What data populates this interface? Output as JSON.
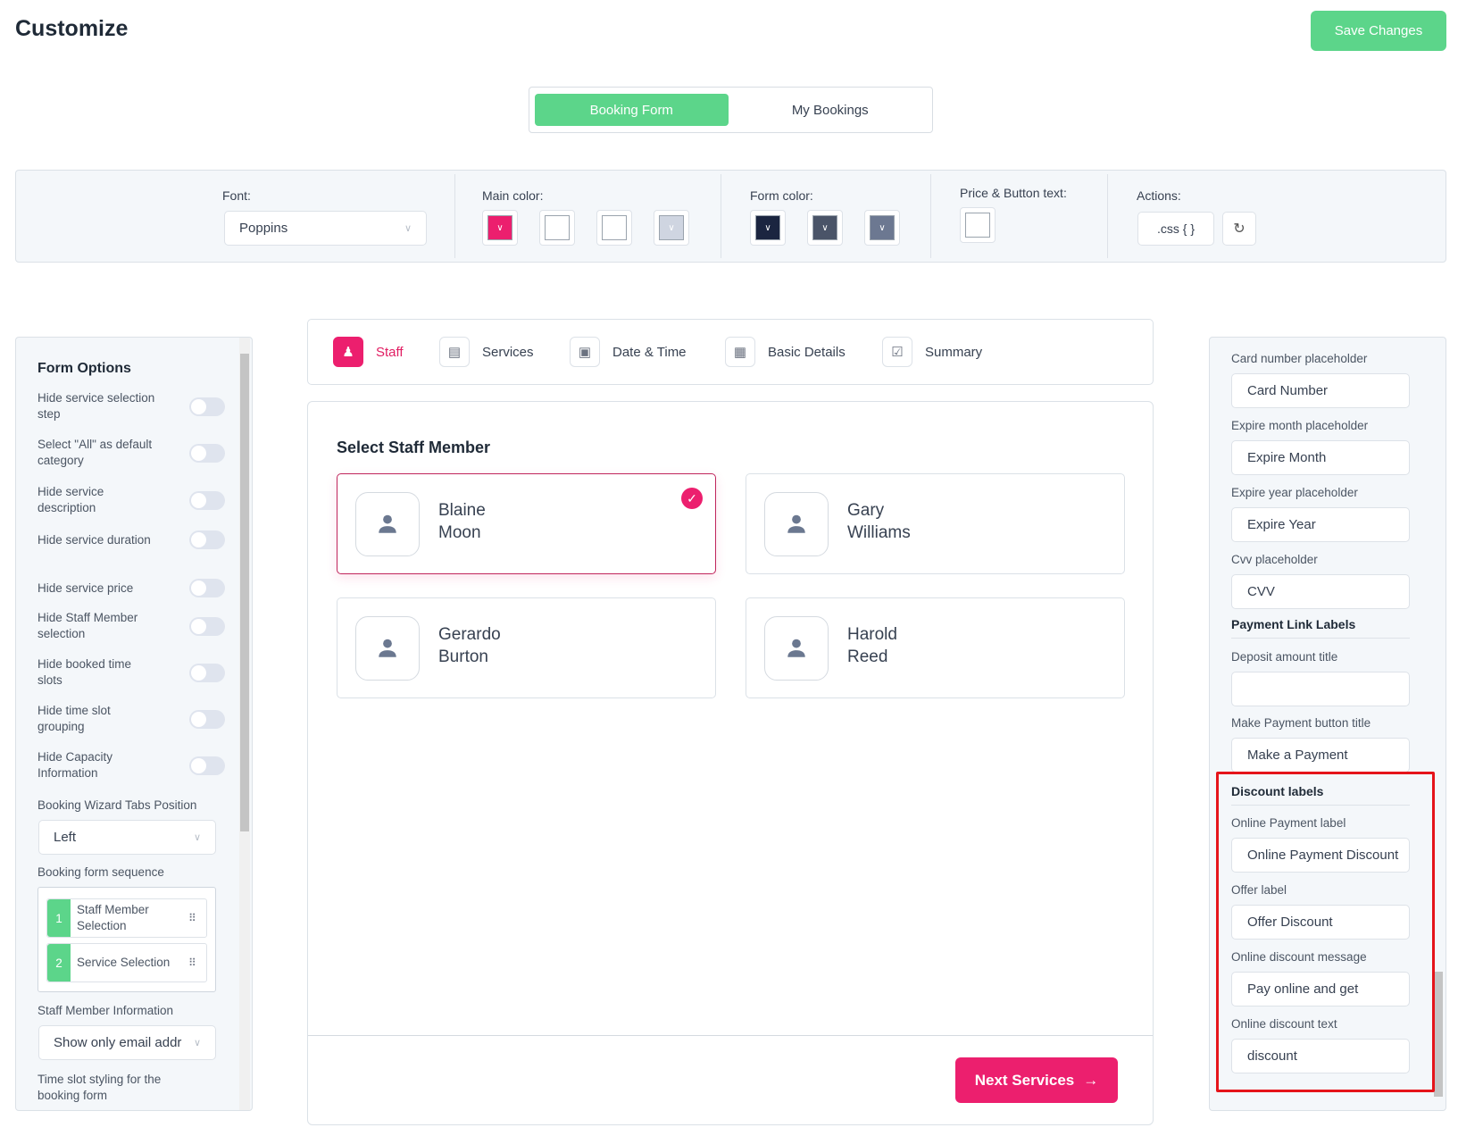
{
  "header": {
    "title": "Customize",
    "save_label": "Save Changes"
  },
  "modes": {
    "booking_form": "Booking Form",
    "my_bookings": "My Bookings",
    "active": "Booking Form"
  },
  "toolbar": {
    "font_label": "Font:",
    "font_value": "Poppins",
    "main_color_label": "Main color:",
    "main_colors": [
      "#ec1f6e",
      "#ffffff",
      "#ffffff",
      "#cfd5e1"
    ],
    "form_color_label": "Form color:",
    "form_colors": [
      "#1b2540",
      "#4a5468",
      "#6c7891"
    ],
    "price_button_label": "Price & Button text:",
    "price_button_color": "#ffffff",
    "actions_label": "Actions:",
    "css_label": ".css { }",
    "reset_icon": "refresh-icon"
  },
  "form_options": {
    "title": "Form Options",
    "toggles": [
      {
        "label": "Hide service selection step",
        "on": false
      },
      {
        "label": "Select \"All\" as default category",
        "on": false
      },
      {
        "label": "Hide service description",
        "on": false
      },
      {
        "label": "Hide service duration",
        "on": false
      },
      {
        "label": "Hide service price",
        "on": false
      },
      {
        "label": "Hide Staff Member selection",
        "on": false
      },
      {
        "label": "Hide booked time slots",
        "on": false
      },
      {
        "label": "Hide time slot grouping",
        "on": false
      },
      {
        "label": "Hide Capacity Information",
        "on": false
      }
    ],
    "tabs_position_label": "Booking Wizard Tabs Position",
    "tabs_position_value": "Left",
    "sequence_label": "Booking form sequence",
    "sequence": [
      {
        "n": "1",
        "label": "Staff Member Selection"
      },
      {
        "n": "2",
        "label": "Service Selection"
      }
    ],
    "staff_info_label": "Staff Member Information",
    "staff_info_value": "Show only email addr",
    "time_slot_label": "Time slot styling for the booking form"
  },
  "steps": [
    {
      "label": "Staff",
      "icon": "users-icon",
      "active": true
    },
    {
      "label": "Services",
      "icon": "services-icon",
      "active": false
    },
    {
      "label": "Date & Time",
      "icon": "calendar-icon",
      "active": false
    },
    {
      "label": "Basic Details",
      "icon": "document-icon",
      "active": false
    },
    {
      "label": "Summary",
      "icon": "clipboard-check-icon",
      "active": false
    }
  ],
  "main": {
    "title": "Select Staff Member",
    "staff": [
      {
        "first": "Blaine",
        "last": "Moon",
        "selected": true
      },
      {
        "first": "Gary",
        "last": "Williams",
        "selected": false
      },
      {
        "first": "Gerardo",
        "last": "Burton",
        "selected": false
      },
      {
        "first": "Harold",
        "last": "Reed",
        "selected": false
      }
    ],
    "next_label": "Next Services",
    "accent": "#ec1f6e"
  },
  "right": {
    "fields": [
      {
        "label": "Card number placeholder",
        "value": "Card Number"
      },
      {
        "label": "Expire month placeholder",
        "value": "Expire Month"
      },
      {
        "label": "Expire year placeholder",
        "value": "Expire Year"
      },
      {
        "label": "Cvv placeholder",
        "value": "CVV"
      }
    ],
    "payment_link_heading": "Payment Link Labels",
    "payment_fields": [
      {
        "label": "Deposit amount title",
        "value": ""
      },
      {
        "label": "Make Payment button title",
        "value": "Make a Payment"
      }
    ],
    "discount_heading": "Discount labels",
    "discount_fields": [
      {
        "label": "Online Payment label",
        "value": "Online Payment Discount"
      },
      {
        "label": "Offer label",
        "value": "Offer Discount"
      },
      {
        "label": "Online discount message",
        "value": "Pay online and get"
      },
      {
        "label": "Online discount text",
        "value": "discount"
      }
    ],
    "highlight_color": "#e5141a"
  }
}
